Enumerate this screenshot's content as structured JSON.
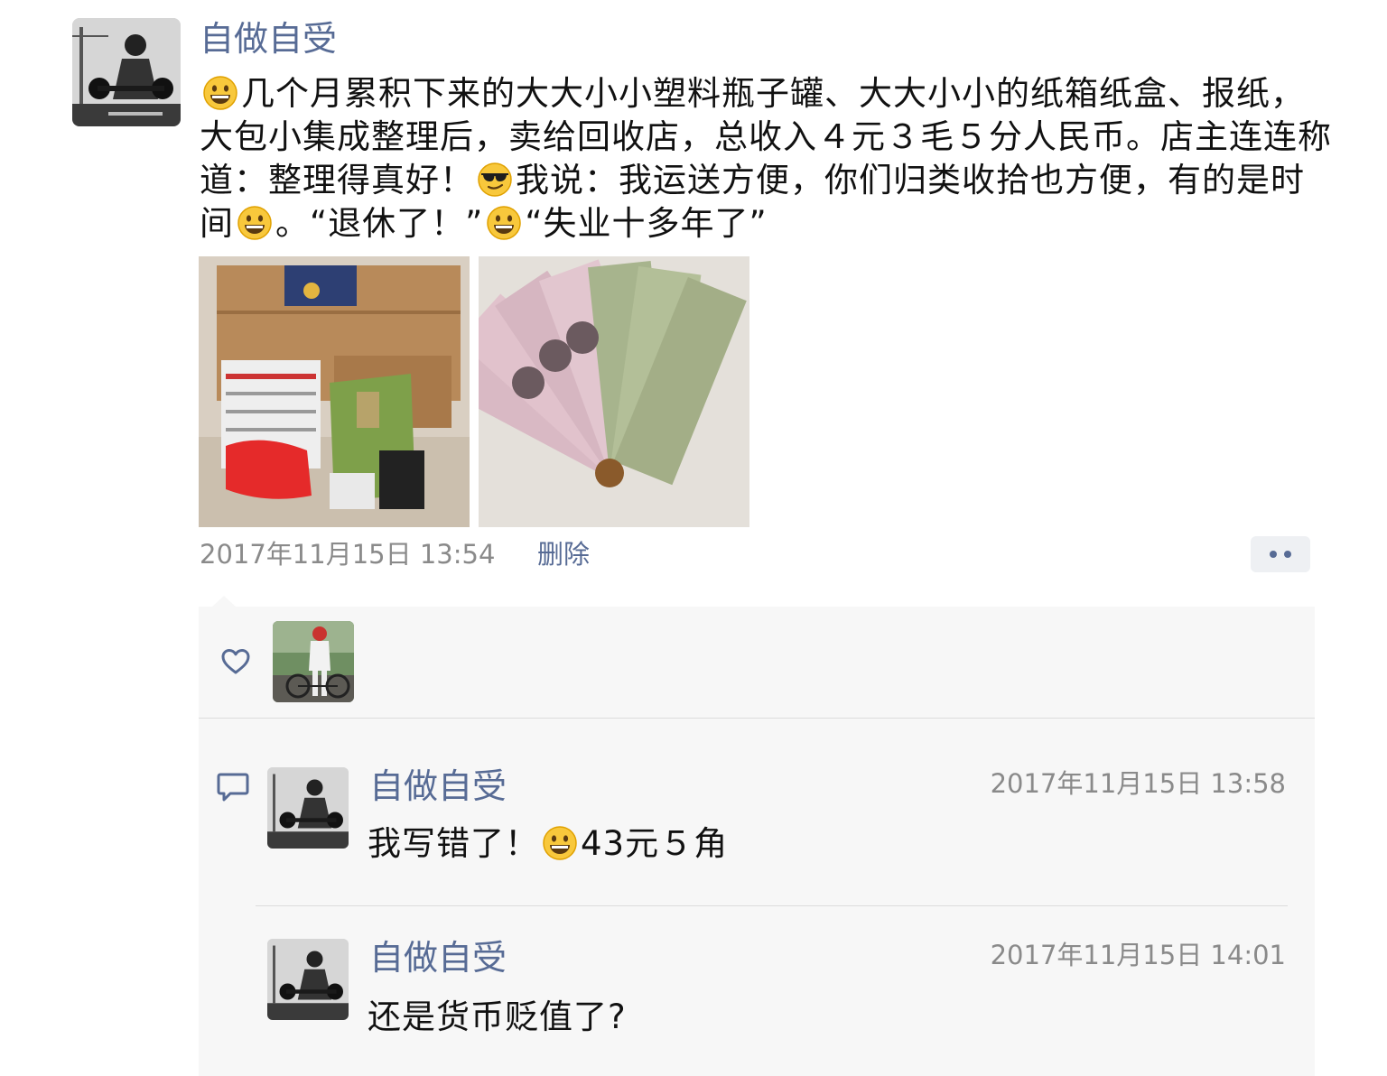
{
  "post": {
    "author": "自做自受",
    "text_segments": [
      {
        "type": "emoji",
        "icon": "grinning-face-emoji"
      },
      {
        "type": "text",
        "value": "几个月累积下来的大大小小塑料瓶子罐、大大小小的纸箱纸盒、报纸，大包小集成整理后，卖给回收店，总收入４元３毛５分人民币。店主连连称道：整理得真好！"
      },
      {
        "type": "emoji",
        "icon": "sunglasses-face-emoji"
      },
      {
        "type": "text",
        "value": "我说：我运送方便，你们归类收拾也方便，有的是时间"
      },
      {
        "type": "emoji",
        "icon": "grinning-face-emoji"
      },
      {
        "type": "text",
        "value": "。“退休了！”"
      },
      {
        "type": "emoji",
        "icon": "grinning-face-emoji"
      },
      {
        "type": "text",
        "value": "“失业十多年了”"
      }
    ],
    "photos": [
      {
        "icon": "recyclables-photo"
      },
      {
        "icon": "banknotes-photo"
      }
    ],
    "timestamp": "2017年11月15日 13:54",
    "delete_label": "删除"
  },
  "likes": {
    "icon": "heart-icon",
    "avatars": [
      "cyclist-avatar"
    ]
  },
  "comments": [
    {
      "author": "自做自受",
      "time": "2017年11月15日 13:58",
      "text_before": "我写错了！",
      "emoji": "grinning-face-emoji",
      "text_after": "43元５角"
    },
    {
      "author": "自做自受",
      "time": "2017年11月15日 14:01",
      "text": "还是货币贬值了?"
    }
  ],
  "colors": {
    "link": "#576b95",
    "meta": "#8a8a8a",
    "panel_bg": "#f7f7f7"
  }
}
